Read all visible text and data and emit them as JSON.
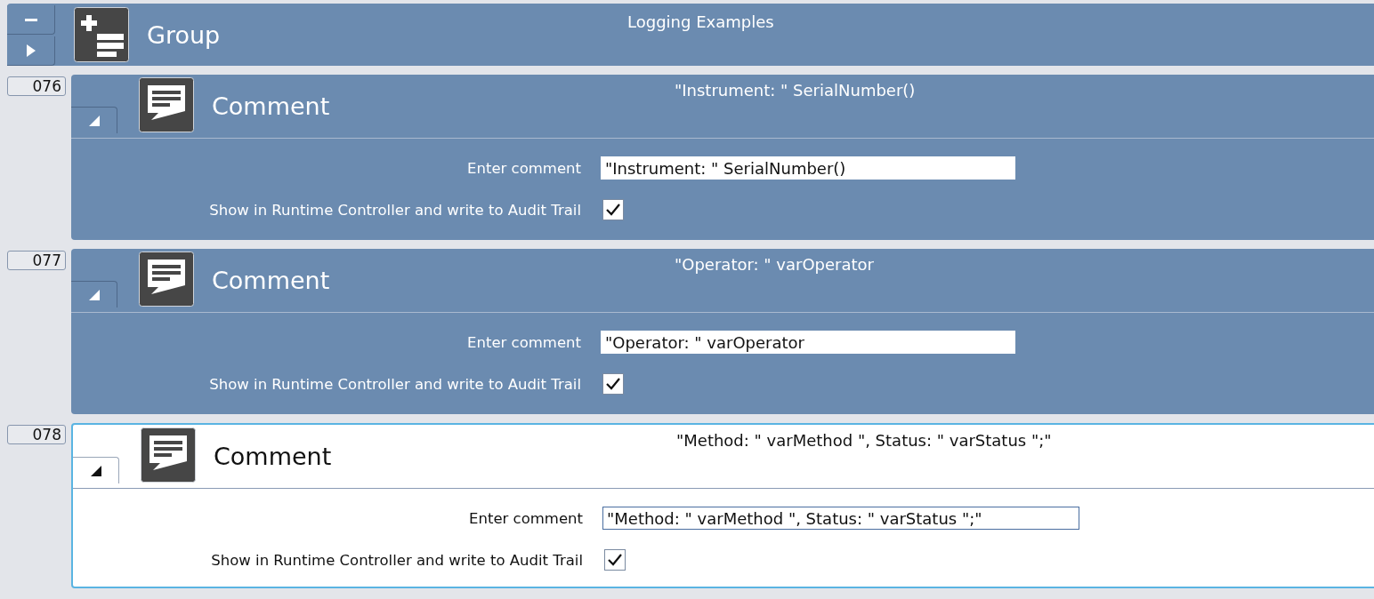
{
  "group": {
    "label": "Group",
    "title": "Logging Examples"
  },
  "steps": [
    {
      "number": "076",
      "label": "Comment",
      "summary": "\"Instrument: \" SerialNumber()",
      "selected": false,
      "expanded": true,
      "comment_label": "Enter comment",
      "comment_value": "\"Instrument: \" SerialNumber()",
      "show_label": "Show in Runtime Controller and write to Audit Trail",
      "show_checked": true
    },
    {
      "number": "077",
      "label": "Comment",
      "summary": "\"Operator: \" varOperator",
      "selected": false,
      "expanded": true,
      "comment_label": "Enter comment",
      "comment_value": "\"Operator: \" varOperator",
      "show_label": "Show in Runtime Controller and write to Audit Trail",
      "show_checked": true
    },
    {
      "number": "078",
      "label": "Comment",
      "summary": "\"Method: \" varMethod \", Status: \" varStatus \";\"",
      "selected": true,
      "expanded": true,
      "comment_label": "Enter comment",
      "comment_value": "\"Method: \" varMethod \", Status: \" varStatus \";\"",
      "show_label": "Show in Runtime Controller and write to Audit Trail",
      "show_checked": true
    }
  ]
}
